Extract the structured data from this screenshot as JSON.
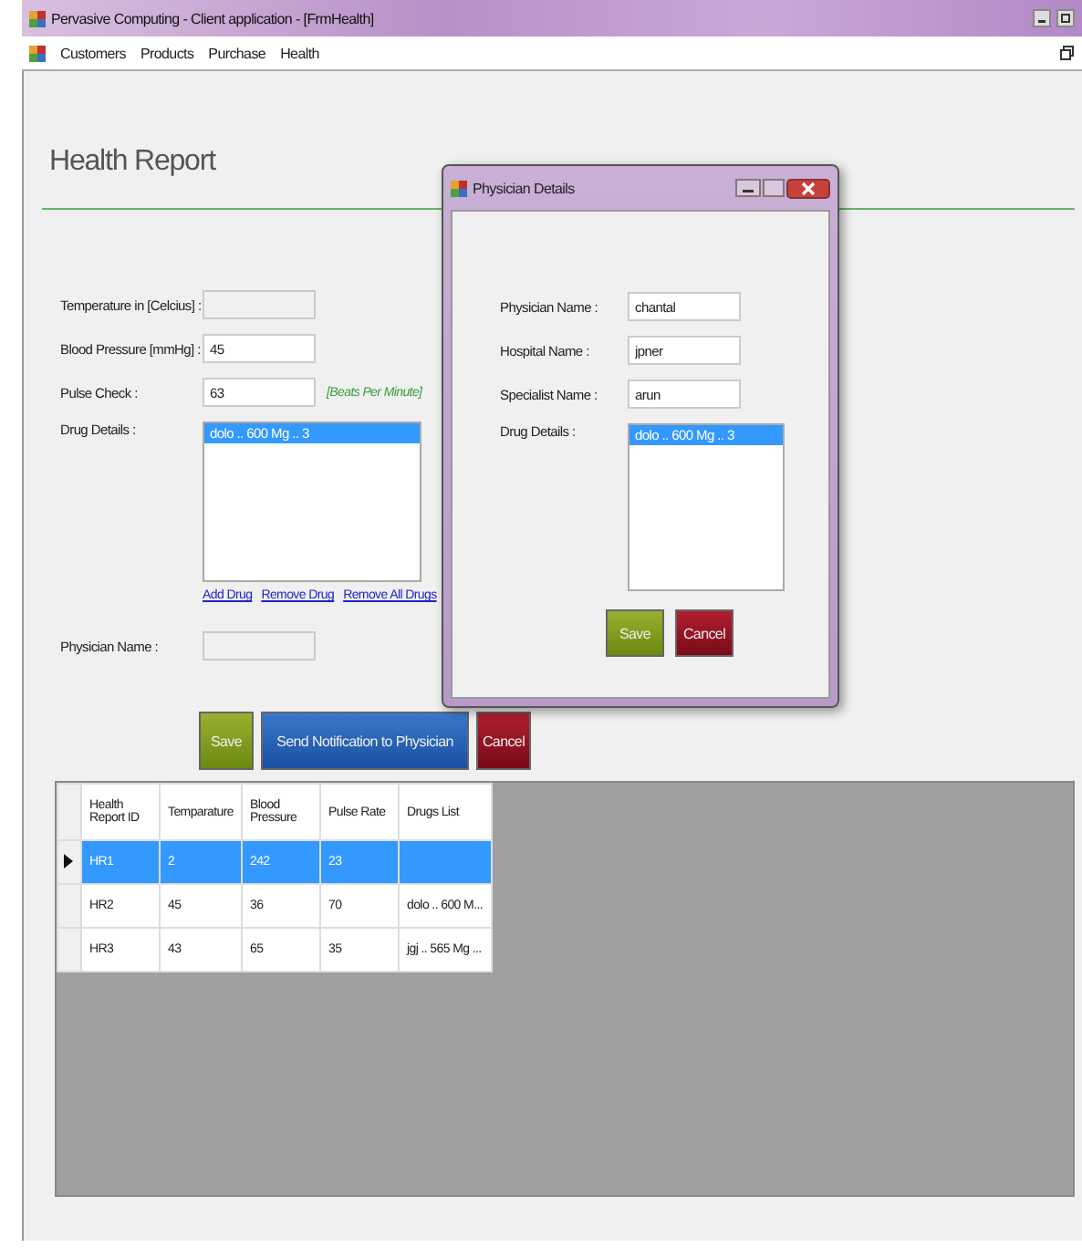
{
  "window": {
    "title": "Pervasive Computing - Client application - [FrmHealth]"
  },
  "menu": [
    "Customers",
    "Products",
    "Purchase",
    "Health"
  ],
  "heading": "Health Report",
  "form": {
    "fields": [
      {
        "label": "Temperature in [Celcius] :",
        "disabled": true
      },
      {
        "label": "Blood Pressure [mmHg] :",
        "value": "45",
        "disabled": false
      },
      {
        "label": "Pulse Check :",
        "value": "63",
        "disabled": false,
        "hint": "[Beats Per Minute]"
      }
    ],
    "drug_label": "Drug Details :",
    "drugs": [
      {
        "text": "dolo .. 600 Mg .. 3",
        "selected": true
      }
    ],
    "links": [
      "Add Drug",
      "Remove Drug",
      "Remove All Drugs"
    ],
    "physician_label": "Physician Name :",
    "physician_disabled": true,
    "buttons": [
      {
        "label": "Save",
        "kind": "save"
      },
      {
        "label": "Send Notification to Physician",
        "kind": "send"
      },
      {
        "label": "Cancel",
        "kind": "cancel"
      }
    ]
  },
  "table": {
    "columns": [
      "Health Report ID",
      "Temparature",
      "Blood Pressure",
      "Pulse Rate",
      "Drugs List"
    ],
    "rows": [
      {
        "selected": true,
        "cells": [
          "HR1",
          "2",
          "242",
          "23",
          null
        ]
      },
      {
        "selected": false,
        "cells": [
          "HR2",
          "45",
          "36",
          "70",
          "dolo .. 600 M..."
        ]
      },
      {
        "selected": false,
        "cells": [
          "HR3",
          "43",
          "65",
          "35",
          "jgj .. 565 Mg ..."
        ]
      }
    ]
  },
  "dialog": {
    "title": "Physician Details",
    "fields": [
      {
        "label": "Physician Name :",
        "value": "chantal"
      },
      {
        "label": "Hospital Name :",
        "value": "jpner"
      },
      {
        "label": "Specialist Name :",
        "value": "arun"
      }
    ],
    "drug_label": "Drug Details :",
    "drugs": [
      {
        "text": "dolo .. 600 Mg .. 3",
        "selected": true
      }
    ],
    "buttons": [
      {
        "label": "Save",
        "kind": "save"
      },
      {
        "label": "Cancel",
        "kind": "cancel"
      }
    ]
  }
}
